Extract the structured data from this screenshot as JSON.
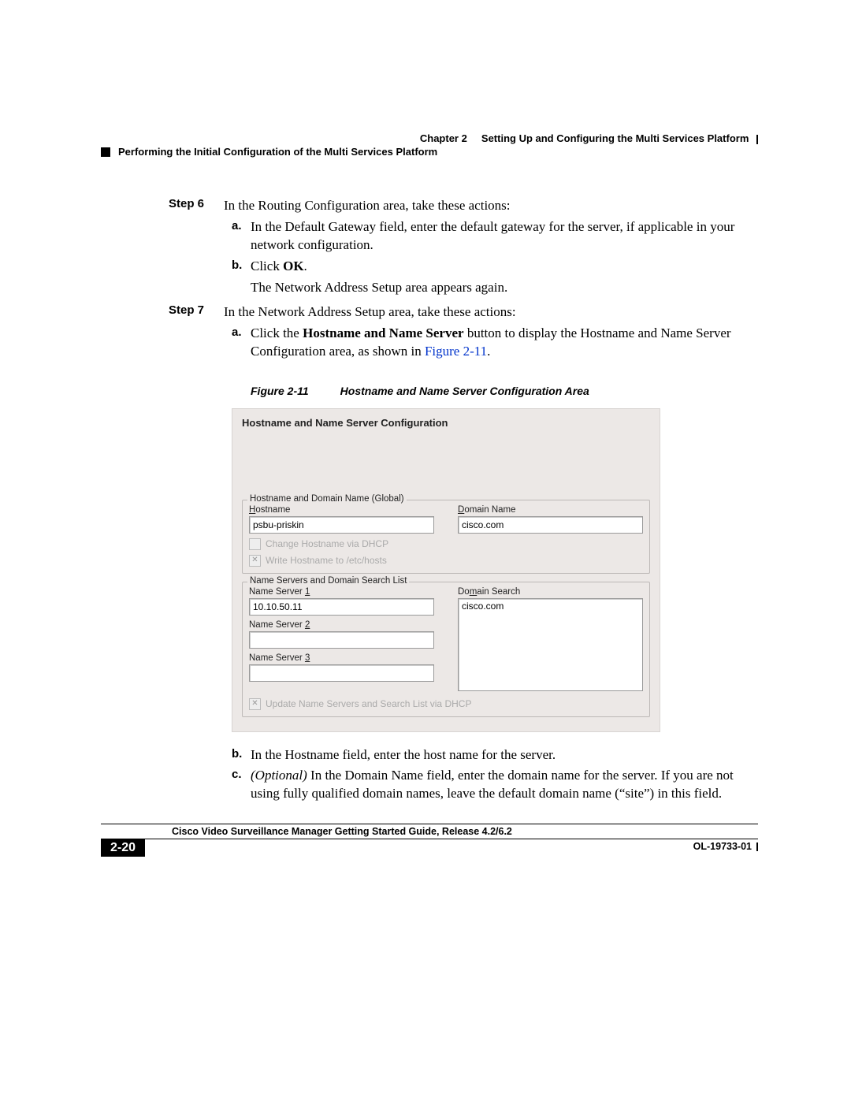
{
  "header": {
    "chapter_label": "Chapter 2",
    "chapter_title": "Setting Up and Configuring the Multi Services Platform",
    "section_title": "Performing the Initial Configuration of the Multi Services Platform"
  },
  "steps": {
    "step6": {
      "label": "Step 6",
      "text": "In the Routing Configuration area, take these actions:",
      "a_label": "a.",
      "a_text": "In the Default Gateway field, enter the default gateway for the server, if applicable in your network configuration.",
      "b_label": "b.",
      "b_prefix": "Click ",
      "b_bold": "OK",
      "b_suffix": ".",
      "b_follow": "The Network Address Setup area appears again."
    },
    "step7": {
      "label": "Step 7",
      "text": "In the Network Address Setup area, take these actions:",
      "a_label": "a.",
      "a_prefix": "Click the ",
      "a_bold": "Hostname and Name Server",
      "a_mid": " button to display the Hostname and Name Server Configuration area, as shown in ",
      "a_link": "Figure 2-11",
      "a_suffix": ".",
      "b_label": "b.",
      "b_text": "In the Hostname field, enter the host name for the server.",
      "c_label": "c.",
      "c_italic": "(Optional)",
      "c_text": " In the Domain Name field, enter the domain name for the server. If you are not using fully qualified domain names, leave the default domain name (“site”) in this field."
    }
  },
  "figure": {
    "number": "Figure 2-11",
    "title": "Hostname and Name Server Configuration Area"
  },
  "shot": {
    "title": "Hostname and Name Server Configuration",
    "fs1": {
      "legend": "Hostname and Domain Name (Global)",
      "hostname_label_pre": "H",
      "hostname_label_rest": "ostname",
      "hostname_value": "psbu-priskin",
      "domain_label_pre": "D",
      "domain_label_rest": "omain Name",
      "domain_value": "cisco.com",
      "chk1": "Change Hostname via DHCP",
      "chk2": "Write Hostname to /etc/hosts"
    },
    "fs2": {
      "legend": "Name Servers and Domain Search List",
      "ns1_label": "Name Server ",
      "ns1_u": "1",
      "ns1_value": "10.10.50.11",
      "ns2_label": "Name Server ",
      "ns2_u": "2",
      "ns2_value": "",
      "ns3_label": "Name Server ",
      "ns3_u": "3",
      "ns3_value": "",
      "ds_label": "Do",
      "ds_u": "m",
      "ds_label2": "ain Search",
      "ds_value": "cisco.com",
      "chk": "Update Name Servers and Search List via DHCP"
    }
  },
  "footer": {
    "guide": "Cisco Video Surveillance Manager Getting Started Guide, Release 4.2/6.2",
    "pagenum": "2-20",
    "docnum": "OL-19733-01"
  }
}
